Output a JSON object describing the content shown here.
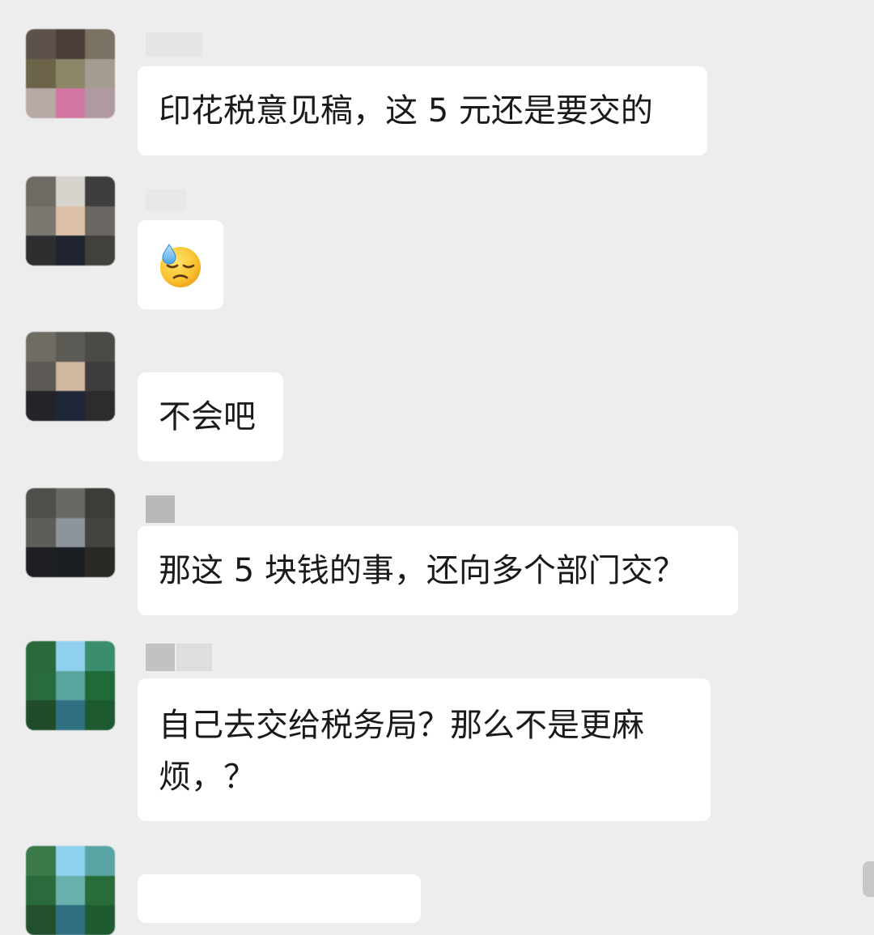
{
  "messages": [
    {
      "text": "印花税意见稿，这 5 元还是要交的"
    },
    {
      "emoji": "downcast-face-with-sweat-icon"
    },
    {
      "text": "不会吧"
    },
    {
      "text": "那这 5 块钱的事，还向多个部门交？"
    },
    {
      "text_line1": "自己去交给税务局？那么不是更麻",
      "text_line2": "烦，？"
    }
  ]
}
